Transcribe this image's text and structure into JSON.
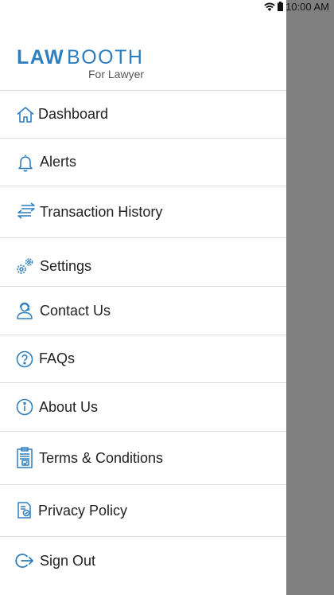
{
  "status_bar": {
    "time": "10:00 AM",
    "icons": [
      "wifi-icon",
      "battery-icon"
    ]
  },
  "brand": {
    "name_bold": "LAW",
    "name_light": "BOOTH",
    "subtitle": "For Lawyer",
    "color": "#2e7fbf"
  },
  "menu": {
    "icon_color": "#2e7fbf",
    "items": [
      {
        "label": "Dashboard",
        "icon": "home-icon"
      },
      {
        "label": "Alerts",
        "icon": "bell-icon"
      },
      {
        "label": "Transaction History",
        "icon": "transfer-arrows-icon"
      },
      {
        "label": "Settings",
        "icon": "gears-icon"
      },
      {
        "label": "Contact Us",
        "icon": "support-agent-icon"
      },
      {
        "label": "FAQs",
        "icon": "question-circle-icon"
      },
      {
        "label": "About Us",
        "icon": "info-circle-icon"
      },
      {
        "label": "Terms & Conditions",
        "icon": "clipboard-check-icon"
      },
      {
        "label": "Privacy Policy",
        "icon": "privacy-document-icon"
      },
      {
        "label": "Sign Out",
        "icon": "sign-out-icon"
      }
    ]
  },
  "scrim_color": "#808080"
}
